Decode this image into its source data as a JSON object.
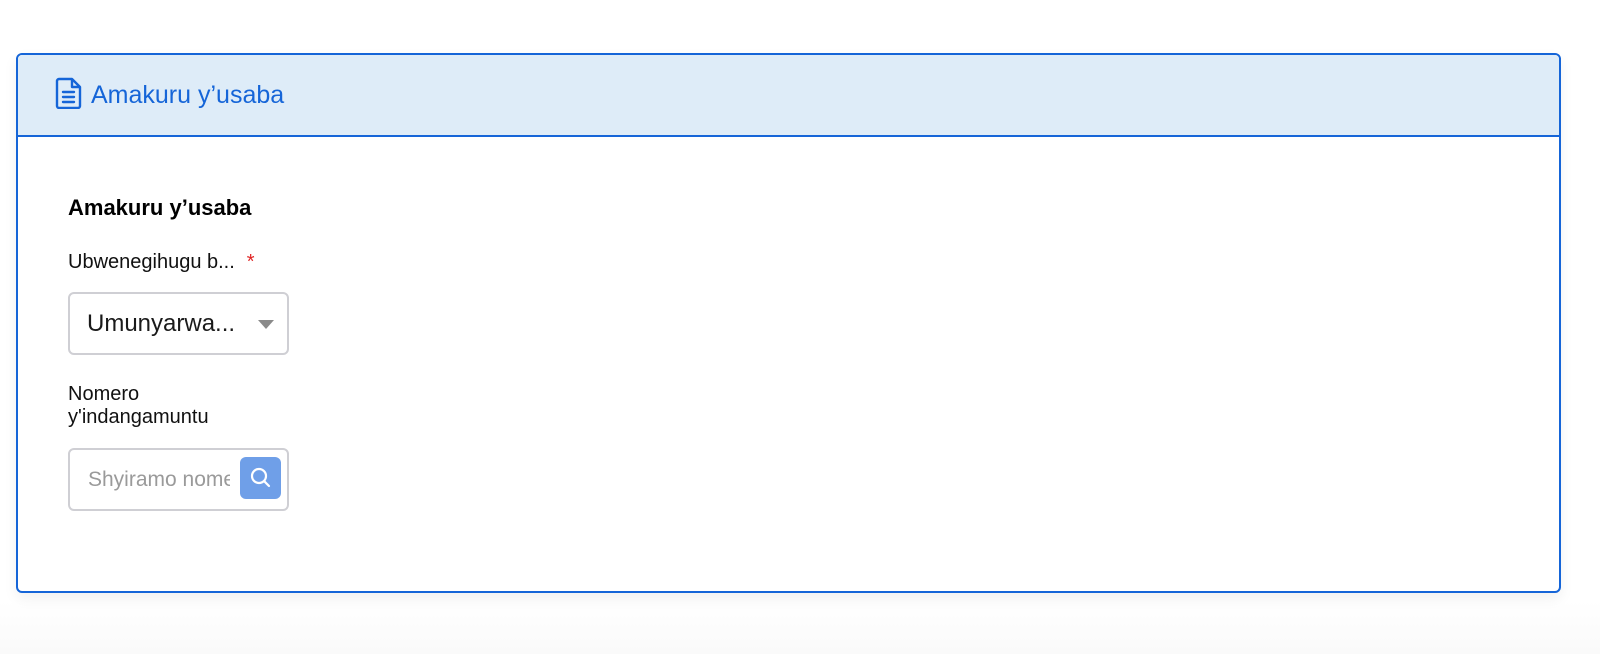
{
  "card": {
    "header_title": "Amakuru y’usaba",
    "header_icon": "document-icon"
  },
  "section": {
    "title": "Amakuru y’usaba"
  },
  "nationality": {
    "label": "Ubwenegihugu b...",
    "required_marker": "*",
    "selected_value": "Umunyarwa...",
    "dropdown_icon": "chevron-down-icon"
  },
  "id_number": {
    "label_line1": "Nomero",
    "label_line2": "y'indangamuntu",
    "placeholder": "Shyiramo nomero",
    "value": "",
    "search_icon": "search-icon"
  },
  "colors": {
    "accent": "#1565d8",
    "header_bg": "#deecf8",
    "search_button": "#6f9fe8",
    "required": "#e02424"
  }
}
